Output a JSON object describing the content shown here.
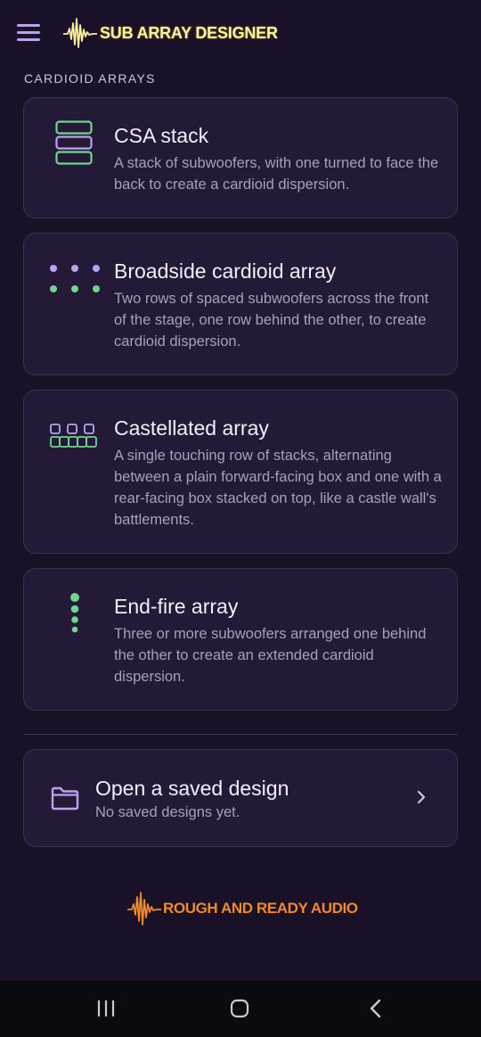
{
  "app": {
    "title": "SUB ARRAY DESIGNER"
  },
  "section": {
    "label": "CARDIOID ARRAYS"
  },
  "cards": [
    {
      "title": "CSA stack",
      "description": "A stack of subwoofers, with one turned to face the back to create a cardioid dispersion."
    },
    {
      "title": "Broadside cardioid array",
      "description": "Two rows of spaced subwoofers across the front of the stage, one row behind the other, to create cardioid dispersion."
    },
    {
      "title": "Castellated array",
      "description": "A single touching row of stacks, alternating between a plain forward-facing box and one with a rear-facing box stacked on top, like a castle wall's battlements."
    },
    {
      "title": "End-fire array",
      "description": "Three or more subwoofers arranged one behind the other to create an extended cardioid dispersion."
    }
  ],
  "saved": {
    "title": "Open a saved design",
    "subtitle": "No saved designs yet."
  },
  "footer": {
    "brand": "ROUGH AND READY AUDIO"
  },
  "colors": {
    "background": "#1a1128",
    "card": "#241a38",
    "green": "#6fd68d",
    "purple": "#b9a4ec",
    "yellow_logo": "#fbf49a",
    "orange_logo": "#f08a2b"
  },
  "icons": {
    "menu": "menu-icon",
    "logo": "waveform-icon",
    "csa": "csa-stack-icon",
    "broadside": "broadside-dots-icon",
    "castellated": "castellated-icon",
    "endfire": "endfire-dots-icon",
    "folder": "folder-icon",
    "chevron": "chevron-right-icon",
    "nav_recents": "recents-icon",
    "nav_home": "home-icon",
    "nav_back": "back-icon"
  }
}
